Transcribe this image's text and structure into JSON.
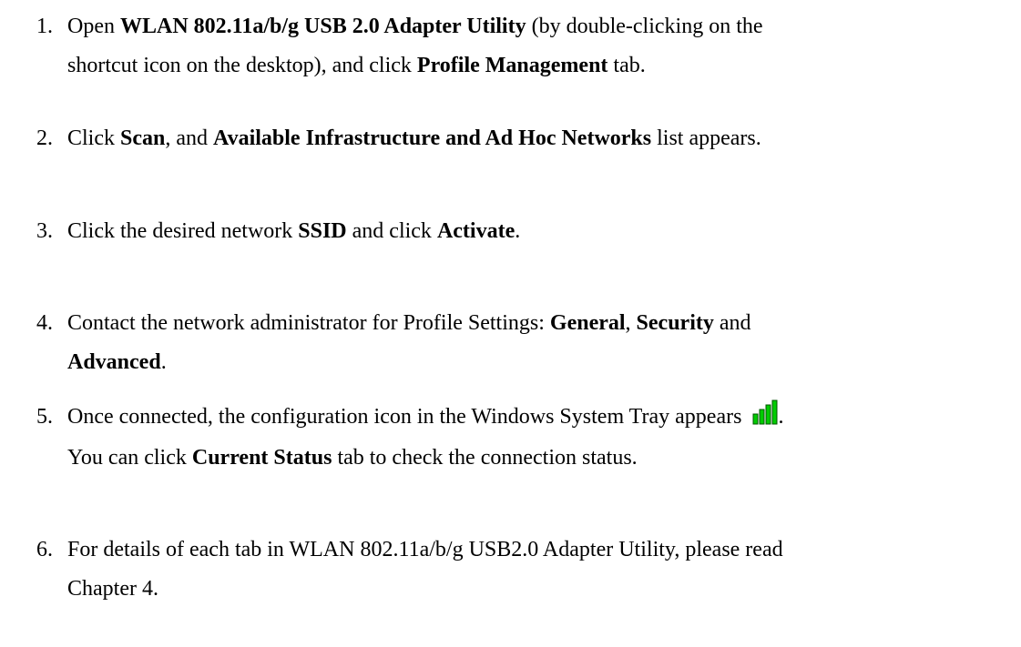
{
  "steps": [
    {
      "number": "1.",
      "parts": [
        {
          "t": "Open ",
          "b": false
        },
        {
          "t": "WLAN 802.11a/b/g USB 2.0 Adapter Utility",
          "b": true
        },
        {
          "t": " (by double-clicking on the",
          "b": false
        },
        {
          "t": "shortcut icon on the desktop), and click ",
          "b": false
        },
        {
          "t": "Profile Management",
          "b": true
        },
        {
          "t": " tab.",
          "b": false
        }
      ]
    },
    {
      "number": "2.",
      "parts": [
        {
          "t": "Click ",
          "b": false
        },
        {
          "t": "Scan",
          "b": true
        },
        {
          "t": ", and ",
          "b": false
        },
        {
          "t": "Available Infrastructure and Ad Hoc Networks",
          "b": true
        },
        {
          "t": " list appears.",
          "b": false
        }
      ]
    },
    {
      "number": "3.",
      "parts": [
        {
          "t": "Click the desired network ",
          "b": false
        },
        {
          "t": "SSID",
          "b": true
        },
        {
          "t": " and click ",
          "b": false
        },
        {
          "t": "Activate",
          "b": true
        },
        {
          "t": ".",
          "b": false
        }
      ]
    },
    {
      "number": "4.",
      "parts": [
        {
          "t": "Contact the network administrator for Profile Settings: ",
          "b": false
        },
        {
          "t": "General",
          "b": true
        },
        {
          "t": ", ",
          "b": false
        },
        {
          "t": "Security",
          "b": true
        },
        {
          "t": " and",
          "b": false
        },
        {
          "t": "Advanced",
          "b": true
        },
        {
          "t": ".",
          "b": false
        }
      ]
    },
    {
      "number": "5.",
      "parts": [
        {
          "t": "Once connected, the configuration icon in the Windows System Tray appears",
          "b": false
        },
        {
          "t": ".",
          "b": false
        },
        {
          "t": "You can click ",
          "b": false
        },
        {
          "t": "Current Status",
          "b": true
        },
        {
          "t": " tab to check the connection status.",
          "b": false
        }
      ]
    },
    {
      "number": "6.",
      "parts": [
        {
          "t": "For details of each tab in WLAN 802.11a/b/g USB2.0 Adapter Utility, please read",
          "b": false
        },
        {
          "t": "Chapter 4.",
          "b": false
        }
      ]
    }
  ],
  "icons": {
    "tray_icon": "signal-strength-icon",
    "tray_icon_color": "#00cc00"
  },
  "colors": {
    "text": "#000000",
    "background": "#ffffff"
  }
}
